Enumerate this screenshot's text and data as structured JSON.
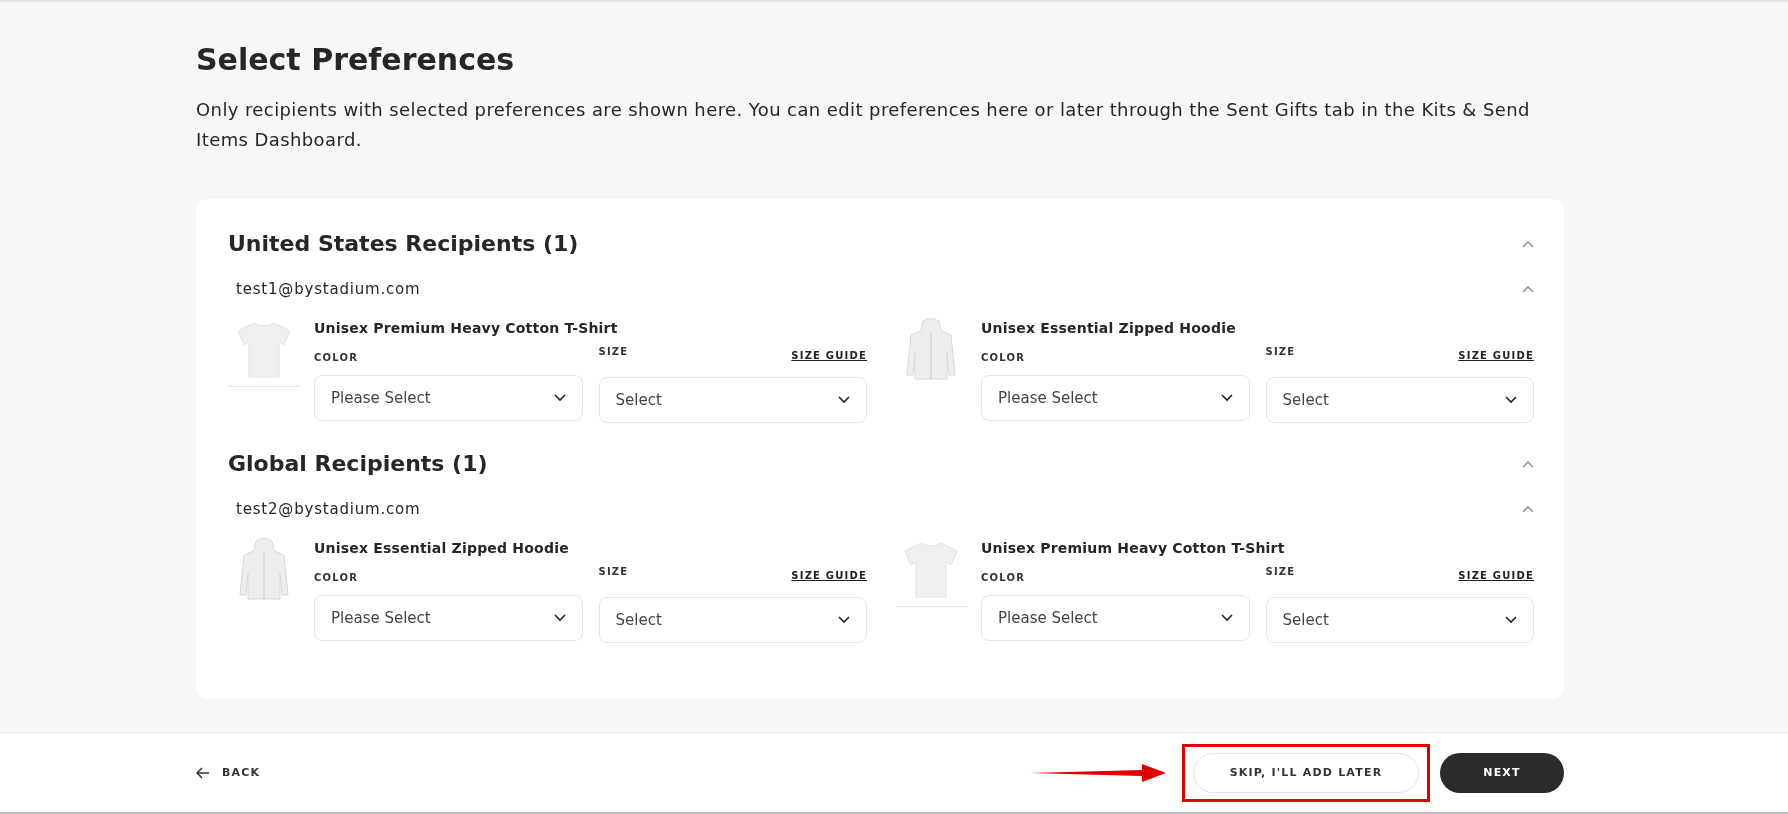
{
  "page": {
    "title": "Select Preferences",
    "description": "Only recipients with selected preferences are shown here. You can edit preferences here or later through the Sent Gifts tab in the Kits & Send Items Dashboard."
  },
  "groups": [
    {
      "title": "United States Recipients (1)",
      "expanded": true,
      "recipients": [
        {
          "email": "test1@bystadium.com",
          "expanded": true,
          "products": [
            {
              "name": "Unisex Premium Heavy Cotton T-Shirt",
              "kind": "tshirt",
              "color_label": "COLOR",
              "color_placeholder": "Please Select",
              "size_label": "SIZE",
              "size_guide": "SIZE GUIDE",
              "size_placeholder": "Select"
            },
            {
              "name": "Unisex Essential Zipped Hoodie",
              "kind": "hoodie",
              "color_label": "COLOR",
              "color_placeholder": "Please Select",
              "size_label": "SIZE",
              "size_guide": "SIZE GUIDE",
              "size_placeholder": "Select"
            }
          ]
        }
      ]
    },
    {
      "title": "Global Recipients (1)",
      "expanded": true,
      "recipients": [
        {
          "email": "test2@bystadium.com",
          "expanded": true,
          "products": [
            {
              "name": "Unisex Essential Zipped Hoodie",
              "kind": "hoodie",
              "color_label": "COLOR",
              "color_placeholder": "Please Select",
              "size_label": "SIZE",
              "size_guide": "SIZE GUIDE",
              "size_placeholder": "Select"
            },
            {
              "name": "Unisex Premium Heavy Cotton T-Shirt",
              "kind": "tshirt",
              "color_label": "COLOR",
              "color_placeholder": "Please Select",
              "size_label": "SIZE",
              "size_guide": "SIZE GUIDE",
              "size_placeholder": "Select"
            }
          ]
        }
      ]
    }
  ],
  "footer": {
    "back": "BACK",
    "skip": "SKIP, I'LL ADD LATER",
    "next": "NEXT"
  }
}
